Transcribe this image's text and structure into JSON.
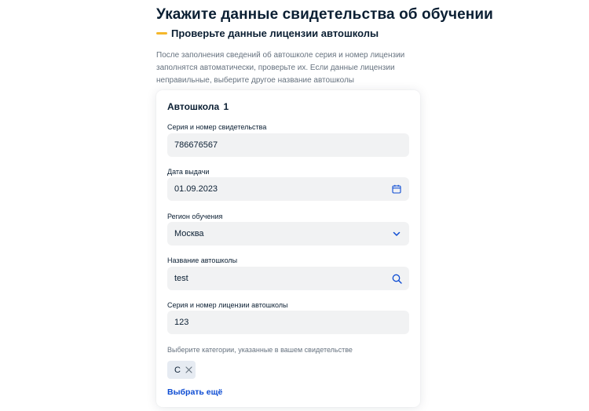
{
  "header": {
    "title": "Укажите данные свидетельства об обучении",
    "step_label": "Проверьте данные лицензии автошколы",
    "intro_text": "После заполнения сведений об автошколе серия и номер лицензии заполнятся автоматически, проверьте их. Если данные лицензии неправильные, выберите другое название автошколы"
  },
  "card": {
    "title": "Автошкола  1",
    "fields": [
      {
        "label": "Серия и номер свидетельства",
        "value": "786676567",
        "icon": ""
      },
      {
        "label": "Дата выдачи",
        "value": "01.09.2023",
        "icon": "calendar-icon"
      },
      {
        "label": "Регион обучения",
        "value": "Москва",
        "icon": "chevron-down-icon"
      },
      {
        "label": "Название автошколы",
        "value": "test",
        "icon": "search-icon"
      },
      {
        "label": "Серия и номер лицензии автошколы",
        "value": "123",
        "icon": ""
      }
    ],
    "categories_hint": "Выберите категории, указанные в вашем свидетельстве",
    "categories": [
      {
        "label": "C",
        "icon": "close-icon"
      }
    ],
    "more_link": "Выбрать ещё"
  },
  "colors": {
    "accent": "#0d4cd3",
    "step_bar": "#f5b72b",
    "field_bg": "#f1f2f3",
    "chip_bg": "#e6ebf2",
    "text": "#0b1f33",
    "muted": "#66727f"
  }
}
